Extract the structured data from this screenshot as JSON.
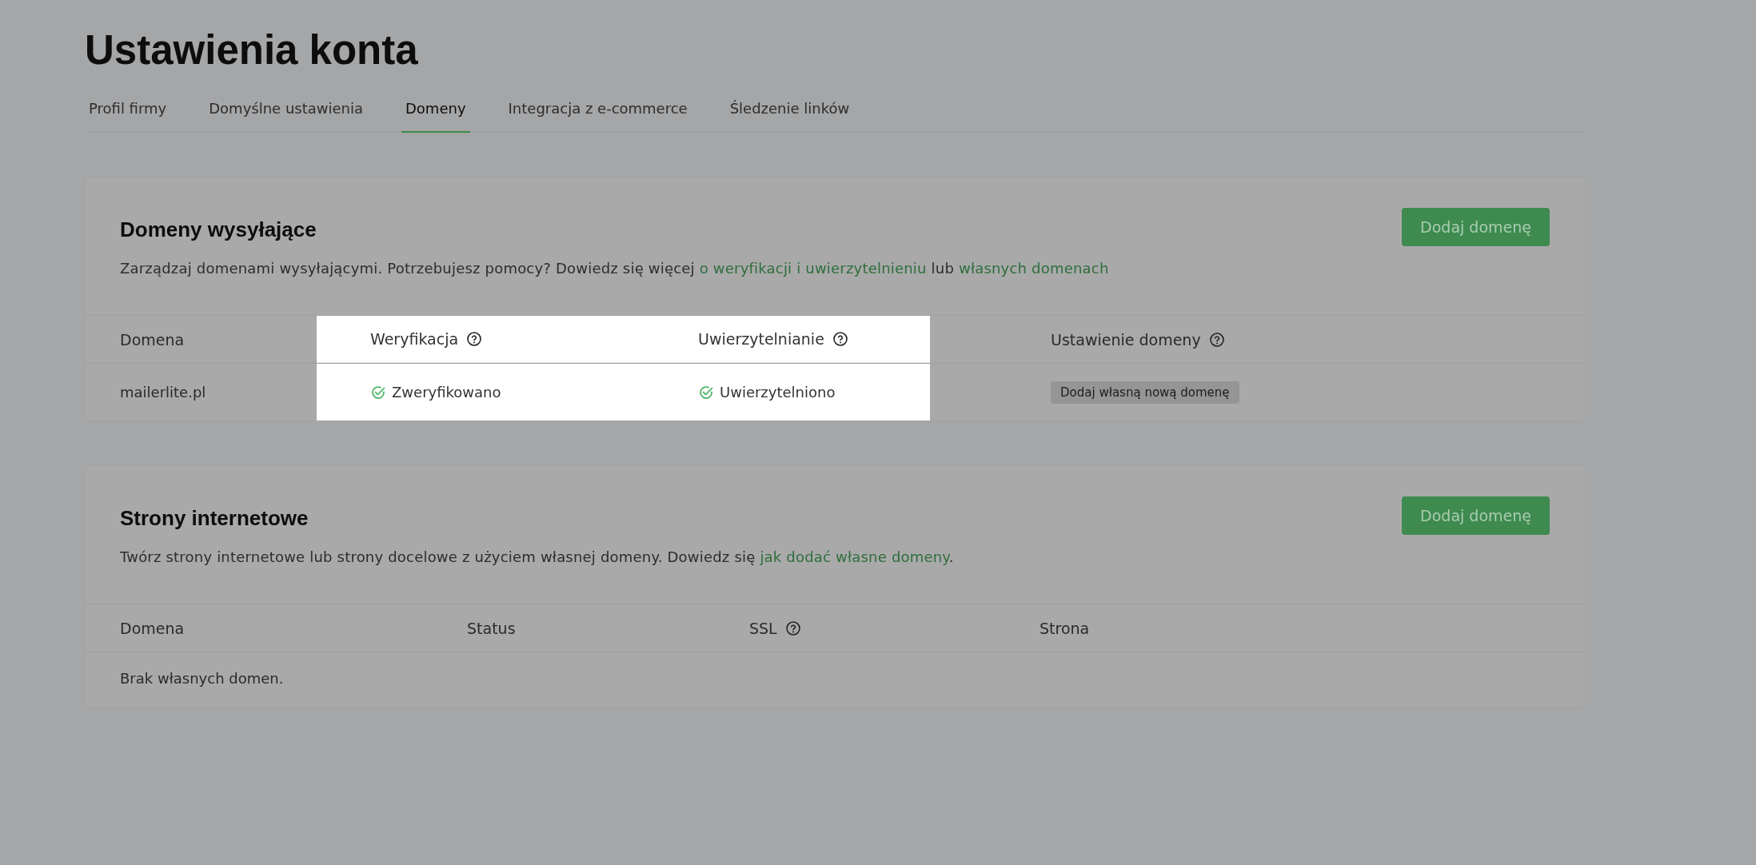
{
  "page_title": "Ustawienia konta",
  "tabs": [
    {
      "label": "Profil firmy",
      "selected": false
    },
    {
      "label": "Domyślne ustawienia",
      "selected": false
    },
    {
      "label": "Domeny",
      "selected": true
    },
    {
      "label": "Integracja z e-commerce",
      "selected": false
    },
    {
      "label": "Śledzenie linków",
      "selected": false
    }
  ],
  "sending_domains": {
    "title": "Domeny wysyłające",
    "description": [
      {
        "kind": "text",
        "text": "Zarządzaj domenami wysyłającymi. Potrzebujesz pomocy? Dowiedz się więcej "
      },
      {
        "kind": "link",
        "text": "o weryfikacji i uwierzytelnieniu"
      },
      {
        "kind": "text",
        "text": " lub "
      },
      {
        "kind": "link",
        "text": "własnych domenach"
      }
    ],
    "button": "Dodaj domenę",
    "columns": [
      {
        "label": "Domena",
        "help": false,
        "highlighted": false
      },
      {
        "label": "Weryfikacja",
        "help": true,
        "highlighted": true
      },
      {
        "label": "Uwierzytelnianie",
        "help": true,
        "highlighted": true
      },
      {
        "label": "Ustawienie domeny",
        "help": true,
        "highlighted": false
      }
    ],
    "rows": [
      {
        "domain": "mailerlite.pl",
        "verification": "Zweryfikowano",
        "authentication": "Uwierzytelniono",
        "setup": "Dodaj własną nową domenę"
      }
    ]
  },
  "websites": {
    "title": "Strony internetowe",
    "description": [
      {
        "kind": "text",
        "text": "Twórz strony internetowe lub strony docelowe z użyciem własnej domeny. Dowiedz się "
      },
      {
        "kind": "link",
        "text": "jak dodać własne domeny"
      },
      {
        "kind": "text",
        "text": "."
      }
    ],
    "button": "Dodaj domenę",
    "columns": [
      {
        "label": "Domena",
        "help": false
      },
      {
        "label": "Status",
        "help": false
      },
      {
        "label": "SSL",
        "help": true
      },
      {
        "label": "Strona",
        "help": false
      }
    ],
    "empty": "Brak własnych domen."
  }
}
